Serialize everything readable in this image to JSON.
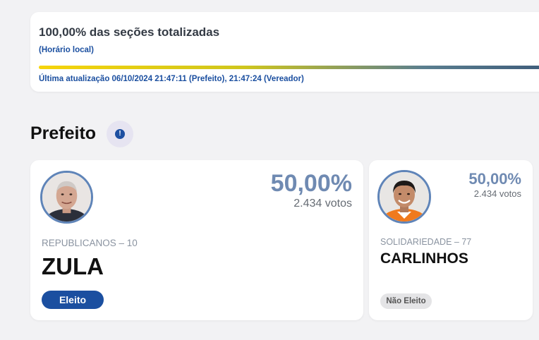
{
  "status": {
    "title": "100,00% das seções totalizadas",
    "note": "(Horário local)",
    "updated": "Última atualização 06/10/2024 21:47:11 (Prefeito), 21:47:24 (Vereador)",
    "progress": 1.0
  },
  "section": {
    "title": "Prefeito",
    "info_icon": "info-icon"
  },
  "candidates": [
    {
      "percent": "50,00%",
      "votes": "2.434 votos",
      "party": "REPUBLICANOS – 10",
      "name": "ZULA",
      "status": "Eleito"
    },
    {
      "percent": "50,00%",
      "votes": "2.434 votos",
      "party": "SOLIDARIEDADE – 77",
      "name": "CARLINHOS",
      "status": "Não Eleito"
    }
  ],
  "colors": {
    "accent_blue": "#1b4fa0",
    "percent_blue": "#6f8ab2",
    "ring": "#5f84b8"
  }
}
